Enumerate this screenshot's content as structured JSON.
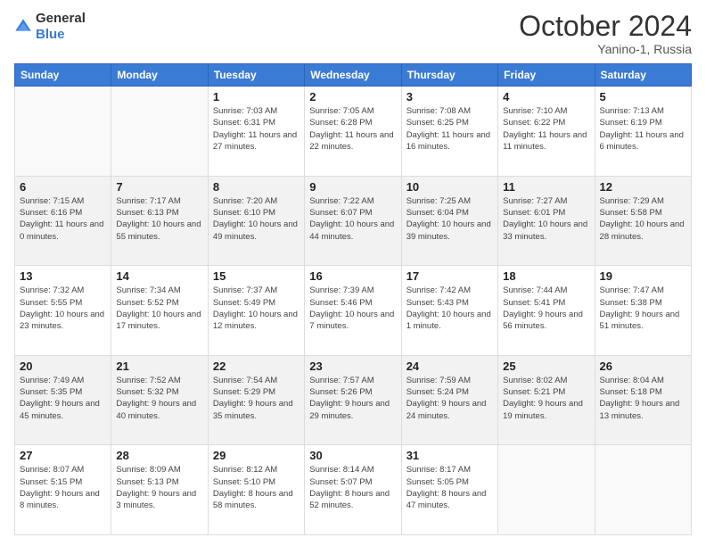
{
  "header": {
    "logo_general": "General",
    "logo_blue": "Blue",
    "month_title": "October 2024",
    "location": "Yanino-1, Russia"
  },
  "days_of_week": [
    "Sunday",
    "Monday",
    "Tuesday",
    "Wednesday",
    "Thursday",
    "Friday",
    "Saturday"
  ],
  "weeks": [
    [
      {
        "day": "",
        "info": ""
      },
      {
        "day": "",
        "info": ""
      },
      {
        "day": "1",
        "info": "Sunrise: 7:03 AM\nSunset: 6:31 PM\nDaylight: 11 hours\nand 27 minutes."
      },
      {
        "day": "2",
        "info": "Sunrise: 7:05 AM\nSunset: 6:28 PM\nDaylight: 11 hours\nand 22 minutes."
      },
      {
        "day": "3",
        "info": "Sunrise: 7:08 AM\nSunset: 6:25 PM\nDaylight: 11 hours\nand 16 minutes."
      },
      {
        "day": "4",
        "info": "Sunrise: 7:10 AM\nSunset: 6:22 PM\nDaylight: 11 hours\nand 11 minutes."
      },
      {
        "day": "5",
        "info": "Sunrise: 7:13 AM\nSunset: 6:19 PM\nDaylight: 11 hours\nand 6 minutes."
      }
    ],
    [
      {
        "day": "6",
        "info": "Sunrise: 7:15 AM\nSunset: 6:16 PM\nDaylight: 11 hours\nand 0 minutes."
      },
      {
        "day": "7",
        "info": "Sunrise: 7:17 AM\nSunset: 6:13 PM\nDaylight: 10 hours\nand 55 minutes."
      },
      {
        "day": "8",
        "info": "Sunrise: 7:20 AM\nSunset: 6:10 PM\nDaylight: 10 hours\nand 49 minutes."
      },
      {
        "day": "9",
        "info": "Sunrise: 7:22 AM\nSunset: 6:07 PM\nDaylight: 10 hours\nand 44 minutes."
      },
      {
        "day": "10",
        "info": "Sunrise: 7:25 AM\nSunset: 6:04 PM\nDaylight: 10 hours\nand 39 minutes."
      },
      {
        "day": "11",
        "info": "Sunrise: 7:27 AM\nSunset: 6:01 PM\nDaylight: 10 hours\nand 33 minutes."
      },
      {
        "day": "12",
        "info": "Sunrise: 7:29 AM\nSunset: 5:58 PM\nDaylight: 10 hours\nand 28 minutes."
      }
    ],
    [
      {
        "day": "13",
        "info": "Sunrise: 7:32 AM\nSunset: 5:55 PM\nDaylight: 10 hours\nand 23 minutes."
      },
      {
        "day": "14",
        "info": "Sunrise: 7:34 AM\nSunset: 5:52 PM\nDaylight: 10 hours\nand 17 minutes."
      },
      {
        "day": "15",
        "info": "Sunrise: 7:37 AM\nSunset: 5:49 PM\nDaylight: 10 hours\nand 12 minutes."
      },
      {
        "day": "16",
        "info": "Sunrise: 7:39 AM\nSunset: 5:46 PM\nDaylight: 10 hours\nand 7 minutes."
      },
      {
        "day": "17",
        "info": "Sunrise: 7:42 AM\nSunset: 5:43 PM\nDaylight: 10 hours\nand 1 minute."
      },
      {
        "day": "18",
        "info": "Sunrise: 7:44 AM\nSunset: 5:41 PM\nDaylight: 9 hours\nand 56 minutes."
      },
      {
        "day": "19",
        "info": "Sunrise: 7:47 AM\nSunset: 5:38 PM\nDaylight: 9 hours\nand 51 minutes."
      }
    ],
    [
      {
        "day": "20",
        "info": "Sunrise: 7:49 AM\nSunset: 5:35 PM\nDaylight: 9 hours\nand 45 minutes."
      },
      {
        "day": "21",
        "info": "Sunrise: 7:52 AM\nSunset: 5:32 PM\nDaylight: 9 hours\nand 40 minutes."
      },
      {
        "day": "22",
        "info": "Sunrise: 7:54 AM\nSunset: 5:29 PM\nDaylight: 9 hours\nand 35 minutes."
      },
      {
        "day": "23",
        "info": "Sunrise: 7:57 AM\nSunset: 5:26 PM\nDaylight: 9 hours\nand 29 minutes."
      },
      {
        "day": "24",
        "info": "Sunrise: 7:59 AM\nSunset: 5:24 PM\nDaylight: 9 hours\nand 24 minutes."
      },
      {
        "day": "25",
        "info": "Sunrise: 8:02 AM\nSunset: 5:21 PM\nDaylight: 9 hours\nand 19 minutes."
      },
      {
        "day": "26",
        "info": "Sunrise: 8:04 AM\nSunset: 5:18 PM\nDaylight: 9 hours\nand 13 minutes."
      }
    ],
    [
      {
        "day": "27",
        "info": "Sunrise: 8:07 AM\nSunset: 5:15 PM\nDaylight: 9 hours\nand 8 minutes."
      },
      {
        "day": "28",
        "info": "Sunrise: 8:09 AM\nSunset: 5:13 PM\nDaylight: 9 hours\nand 3 minutes."
      },
      {
        "day": "29",
        "info": "Sunrise: 8:12 AM\nSunset: 5:10 PM\nDaylight: 8 hours\nand 58 minutes."
      },
      {
        "day": "30",
        "info": "Sunrise: 8:14 AM\nSunset: 5:07 PM\nDaylight: 8 hours\nand 52 minutes."
      },
      {
        "day": "31",
        "info": "Sunrise: 8:17 AM\nSunset: 5:05 PM\nDaylight: 8 hours\nand 47 minutes."
      },
      {
        "day": "",
        "info": ""
      },
      {
        "day": "",
        "info": ""
      }
    ]
  ]
}
